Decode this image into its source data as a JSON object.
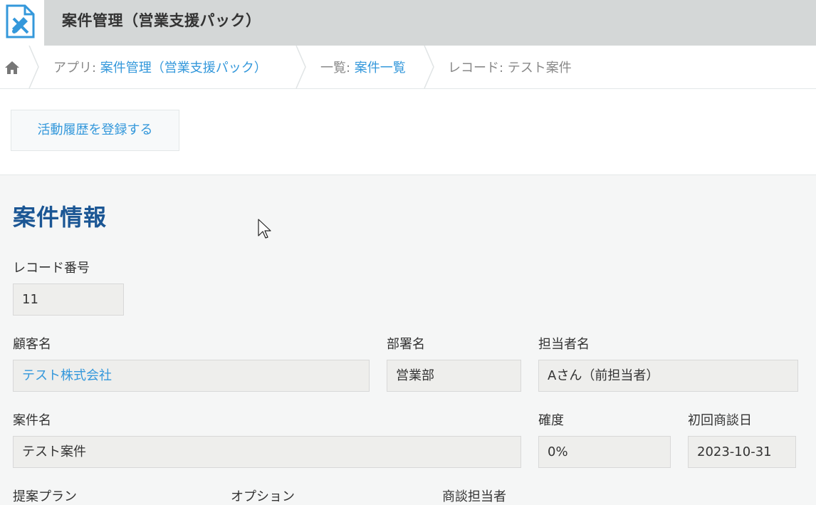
{
  "app": {
    "title": "案件管理（営業支援パック）",
    "icon": "app-document-icon"
  },
  "breadcrumb": {
    "home_icon": "home-icon",
    "app_prefix": "アプリ: ",
    "app_link": "案件管理（営業支援パック）",
    "list_prefix": "一覧: ",
    "list_link": "案件一覧",
    "record": "レコード: テスト案件"
  },
  "toolbar": {
    "register_activity": "活動履歴を登録する"
  },
  "section": {
    "title": "案件情報"
  },
  "fields": {
    "record_number": {
      "label": "レコード番号",
      "value": "11"
    },
    "customer": {
      "label": "顧客名",
      "value": "テスト株式会社"
    },
    "department": {
      "label": "部署名",
      "value": "営業部"
    },
    "person": {
      "label": "担当者名",
      "value": "Aさん（前担当者）"
    },
    "deal_name": {
      "label": "案件名",
      "value": "テスト案件"
    },
    "probability": {
      "label": "確度",
      "value": "0%"
    },
    "first_meeting": {
      "label": "初回商談日",
      "value": "2023-10-31"
    },
    "plan": {
      "label": "提案プラン"
    },
    "option": {
      "label": "オプション"
    },
    "negotiator": {
      "label": "商談担当者"
    }
  },
  "colors": {
    "header_bg": "#d4d7d7",
    "link": "#3498db",
    "section_title": "#1b5694",
    "body_bg": "#f5f6f6"
  }
}
